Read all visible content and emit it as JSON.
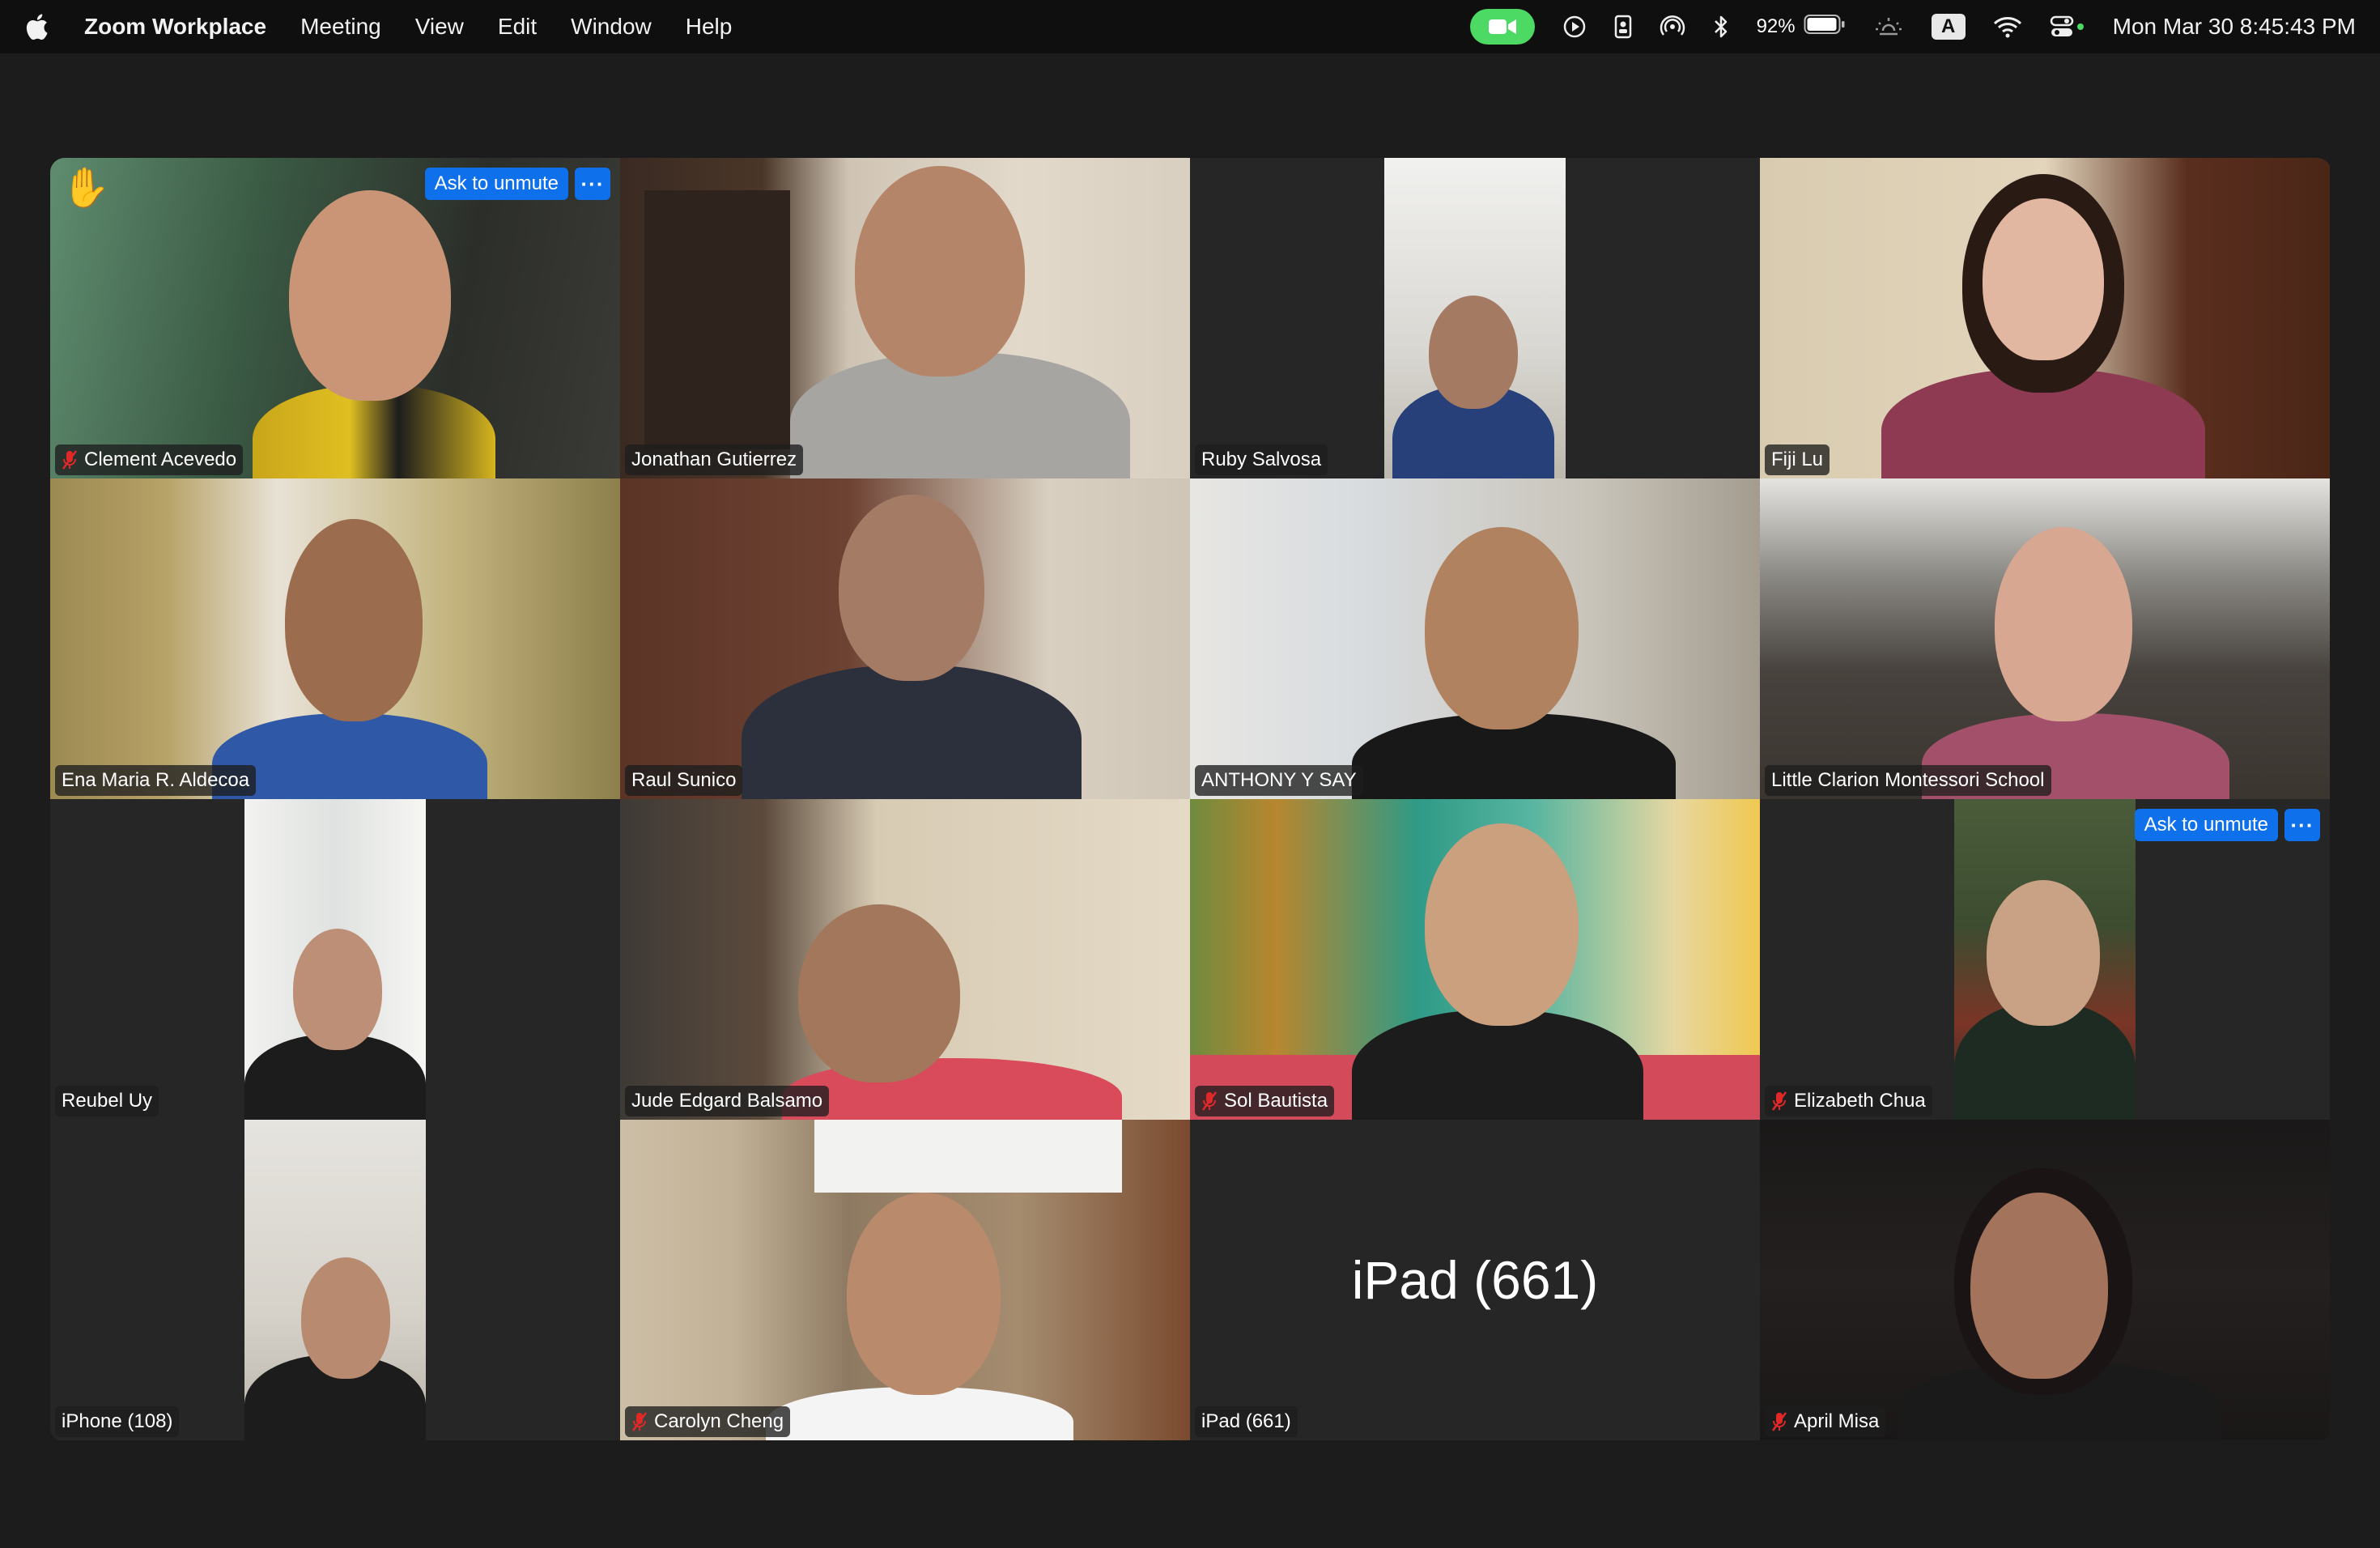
{
  "menubar": {
    "app_name": "Zoom Workplace",
    "menus": [
      "Meeting",
      "View",
      "Edit",
      "Window",
      "Help"
    ],
    "battery_percent": "92%",
    "input_source": "A",
    "clock": "Mon Mar 30  8:45:43 PM"
  },
  "gallery": {
    "tiles": [
      {
        "name": "Clement Acevedo",
        "muted": true,
        "raised_hand": true,
        "ask_to_unmute": "Ask to unmute",
        "more": "···"
      },
      {
        "name": "Jonathan Gutierrez",
        "muted": false,
        "active_speaker": true
      },
      {
        "name": "Ruby Salvosa",
        "muted": false
      },
      {
        "name": "Fiji Lu",
        "muted": false
      },
      {
        "name": "Ena Maria R. Aldecoa",
        "muted": false
      },
      {
        "name": "Raul Sunico",
        "muted": false
      },
      {
        "name": "ANTHONY Y SAY",
        "muted": false
      },
      {
        "name": "Little Clarion Montessori School",
        "muted": false
      },
      {
        "name": "Reubel Uy",
        "muted": false
      },
      {
        "name": "Jude Edgard Balsamo",
        "muted": false
      },
      {
        "name": "Sol Bautista",
        "muted": true
      },
      {
        "name": "Elizabeth Chua",
        "muted": true,
        "ask_to_unmute": "Ask to unmute",
        "more": "···"
      },
      {
        "name": "iPhone (108)",
        "muted": false
      },
      {
        "name": "Carolyn Cheng",
        "muted": true
      },
      {
        "name": "iPad (661)",
        "muted": false,
        "video_off": true,
        "center_label": "iPad (661)"
      },
      {
        "name": "April Misa",
        "muted": true
      }
    ]
  },
  "colors": {
    "active_speaker_border": "#3fbf49",
    "unmute_button": "#0e71eb",
    "mute_icon": "#e02828",
    "zoom_indicator": "#4cd964"
  }
}
